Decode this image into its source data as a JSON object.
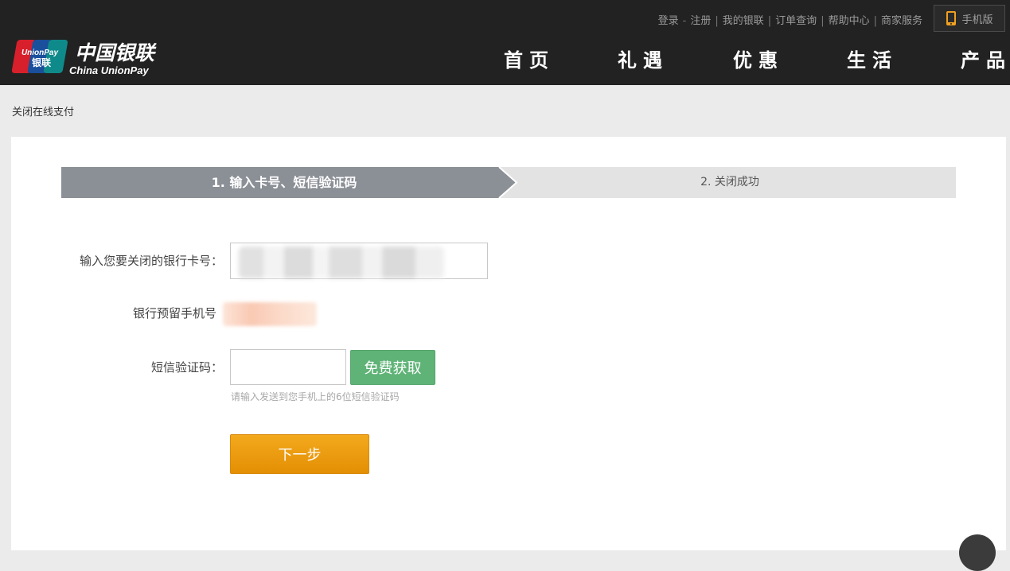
{
  "header": {
    "logo": {
      "badge_top": "UnionPay",
      "badge_bottom": "银联",
      "cn_name": "中国银联",
      "en_name": "China UnionPay"
    },
    "top_links": [
      "登录",
      "注册",
      "我的银联",
      "订单查询",
      "帮助中心",
      "商家服务"
    ],
    "mobile_label": "手机版",
    "nav": [
      "首页",
      "礼遇",
      "优惠",
      "生活",
      "产品"
    ]
  },
  "breadcrumb": "关闭在线支付",
  "steps": {
    "step1": "1. 输入卡号、短信验证码",
    "step2": "2. 关闭成功"
  },
  "form": {
    "card_label": "输入您要关闭的银行卡号：",
    "phone_label": "银行预留手机号",
    "sms_label": "短信验证码：",
    "sms_button": "免费获取",
    "sms_hint": "请输入发送到您手机上的6位短信验证码",
    "next_button": "下一步"
  },
  "colors": {
    "header_bg": "#222222",
    "step_active": "#8b8f96",
    "sms_button": "#5fb377",
    "next_button": "#e8960c"
  }
}
